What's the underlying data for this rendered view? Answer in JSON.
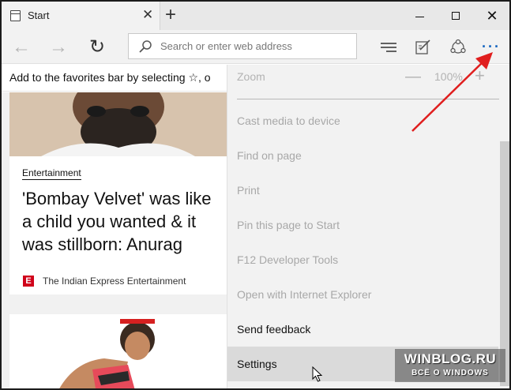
{
  "tab": {
    "title": "Start",
    "close_glyph": "✕"
  },
  "new_tab_glyph": "+",
  "window_controls": {
    "close_glyph": "✕"
  },
  "nav": {
    "back_glyph": "←",
    "forward_glyph": "→",
    "refresh_glyph": "↻",
    "address_placeholder": "Search or enter web address",
    "more_glyph": "···"
  },
  "favorites_bar": {
    "text": "Add to the favorites bar by selecting ☆, o"
  },
  "article": {
    "category": "Entertainment",
    "headline": "'Bombay Velvet' was like a child you wanted & it was stillborn: Anurag",
    "source_icon_letter": "E",
    "source": "The Indian Express Entertainment"
  },
  "menu": {
    "zoom_label": "Zoom",
    "zoom_minus": "—",
    "zoom_value": "100%",
    "zoom_plus": "+",
    "items": [
      {
        "label": "Cast media to device"
      },
      {
        "label": "Find on page"
      },
      {
        "label": "Print"
      },
      {
        "label": "Pin this page to Start"
      },
      {
        "label": "F12 Developer Tools"
      },
      {
        "label": "Open with Internet Explorer"
      },
      {
        "label": "Send feedback"
      },
      {
        "label": "Settings"
      }
    ]
  },
  "watermark": {
    "main": "WINBLOG.RU",
    "sub": "ВСЁ О WINDOWS"
  },
  "colors": {
    "accent": "#1565c0",
    "annotation_arrow": "#e01e1e",
    "source_badge": "#d0021b"
  }
}
